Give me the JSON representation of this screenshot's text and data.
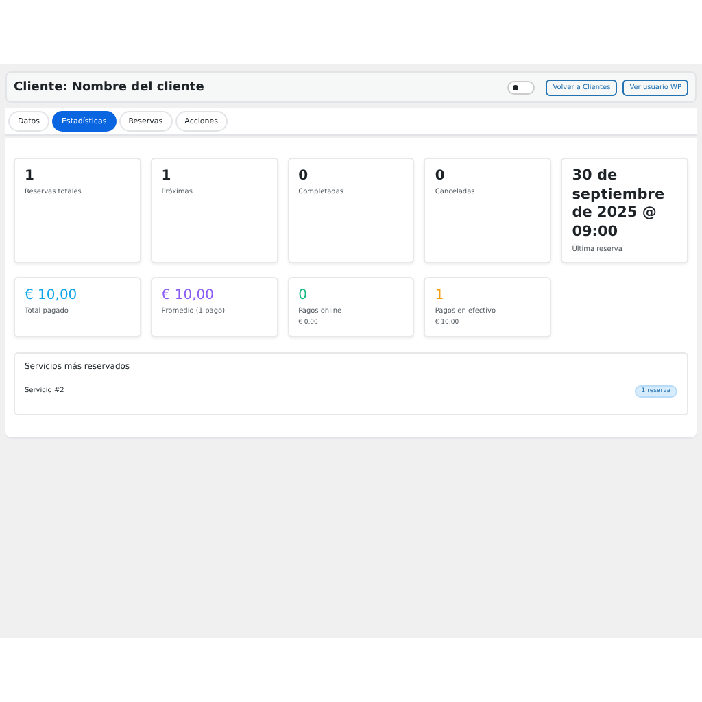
{
  "header": {
    "title": "Cliente: Nombre del cliente",
    "toggle": {
      "on": false
    },
    "buttons": [
      "Volver a Clientes",
      "Ver usuario WP"
    ]
  },
  "tabs": [
    {
      "label": "Datos",
      "selected": false
    },
    {
      "label": "Estadísticas",
      "selected": true
    },
    {
      "label": "Reservas",
      "selected": false
    },
    {
      "label": "Acciones",
      "selected": false
    }
  ],
  "stats": [
    {
      "value": "1",
      "label": "Reservas totales",
      "kind": "plain"
    },
    {
      "value": "1",
      "label": "Próximas",
      "kind": "plain"
    },
    {
      "value": "0",
      "label": "Completadas",
      "kind": "plain"
    },
    {
      "value": "0",
      "label": "Canceladas",
      "kind": "plain"
    },
    {
      "value": "30 de septiembre de 2025 @ 09:00",
      "label": "Última reserva",
      "kind": "plain"
    },
    {
      "value": "€ 10,00",
      "label": "Total pagado",
      "kind": "colored",
      "color": "#0ea5e9"
    },
    {
      "value": "€ 10,00",
      "label": "Promedio (1 pago)",
      "kind": "colored",
      "color": "#8b5cf6"
    },
    {
      "value": "0",
      "label": "Pagos online",
      "sub": "€ 0,00",
      "kind": "colored",
      "color": "#10b981"
    },
    {
      "value": "1",
      "label": "Pagos en efectivo",
      "sub": "€ 10,00",
      "kind": "colored",
      "color": "#f59e0b"
    }
  ],
  "services": {
    "title": "Servicios más reservados",
    "rows": [
      {
        "name": "Servicio #2",
        "badge": "1 reserva"
      }
    ]
  }
}
